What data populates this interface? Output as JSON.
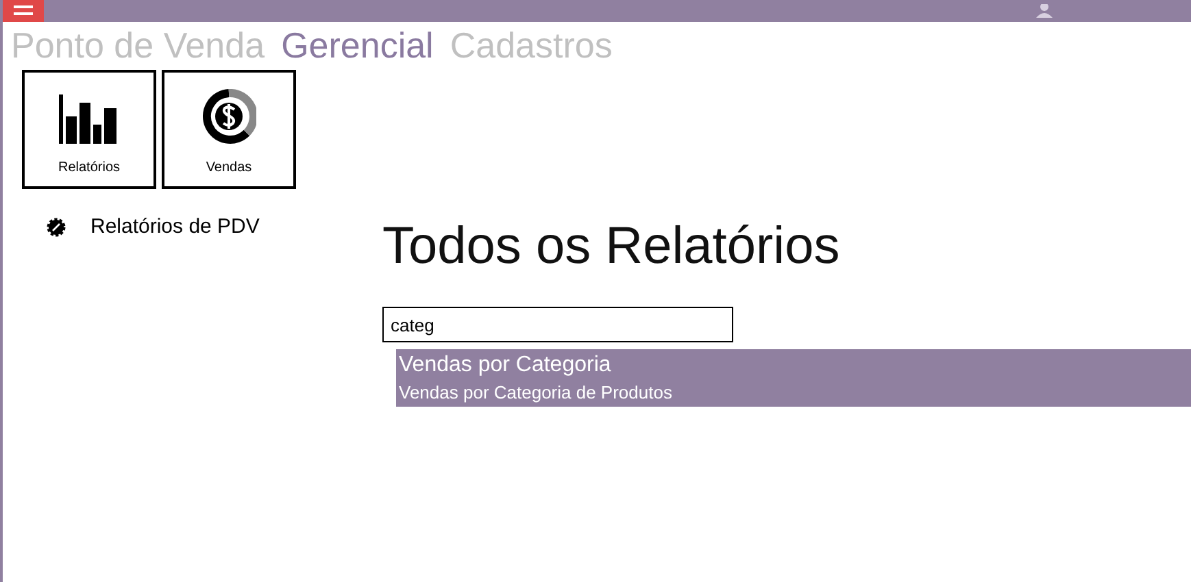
{
  "nav_tabs": [
    {
      "label": "Ponto de Venda",
      "selected": false
    },
    {
      "label": "Gerencial",
      "selected": true
    },
    {
      "label": "Cadastros",
      "selected": false
    }
  ],
  "tiles": [
    {
      "label": "Relatórios",
      "kind": "chart"
    },
    {
      "label": "Vendas",
      "kind": "money"
    }
  ],
  "sidebar": {
    "items": [
      {
        "label": "Relatórios de PDV"
      }
    ]
  },
  "page_title": "Todos os Relatórios",
  "search": {
    "value": "categ"
  },
  "results": [
    {
      "title": "Vendas por Categoria",
      "subtitle": "Vendas por Categoria de Produtos",
      "selected": true
    }
  ]
}
